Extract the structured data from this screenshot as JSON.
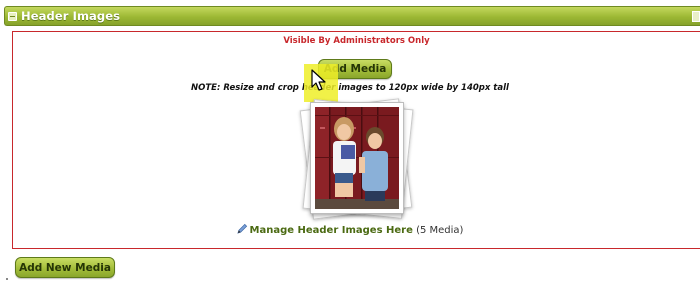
{
  "panel": {
    "title": "Header Images"
  },
  "content": {
    "visibility_note": "Visible By Administrators Only",
    "add_media_label": "Add Media",
    "resize_note": "NOTE: Resize and crop header images to 120px wide by 140px tall",
    "manage_link_label": "Manage Header Images Here",
    "media_count": "(5 Media)"
  },
  "footer": {
    "add_new_media_label": "Add New Media"
  },
  "colors": {
    "brand_green": "#9cb834",
    "alert_red": "#c8282c",
    "link_green": "#4b6a12",
    "highlight_yellow": "#eeee28"
  },
  "icons": {
    "collapse": "collapse-icon",
    "pencil": "pencil-icon",
    "cursor": "pointer-cursor-icon"
  }
}
